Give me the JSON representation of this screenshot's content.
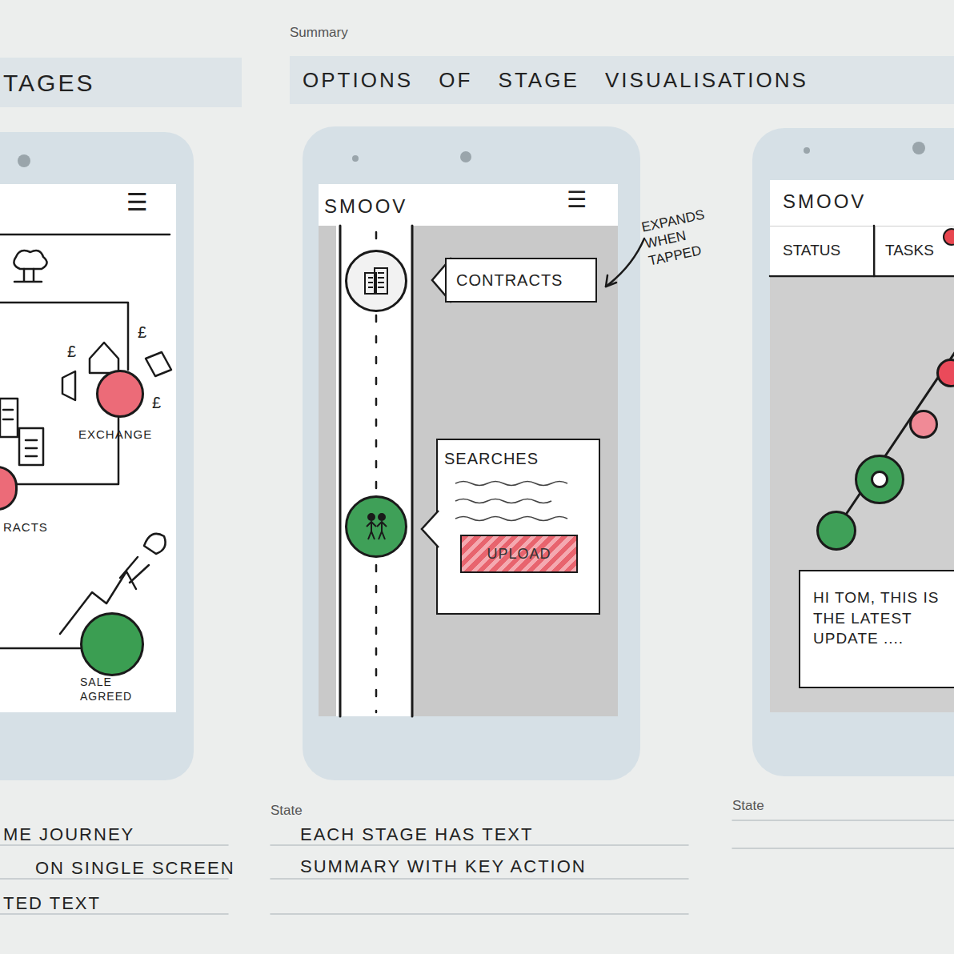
{
  "sheet": {
    "summary_label": "Summary",
    "title": "OPTIONS OF STAGE VISUALISATIONS"
  },
  "left_panel": {
    "title": "TAGES",
    "menu_icon": "☰",
    "money_symbols": [
      "£",
      "£",
      "£"
    ],
    "nodes": [
      {
        "label": "EXCHANGE",
        "color": "#ec6b78"
      },
      {
        "label": "RACTS",
        "color": "#ec6b78"
      },
      {
        "label": "SALE AGREED",
        "color": "#3b9e52"
      }
    ],
    "caption_lines": [
      "ME JOURNEY",
      "ON SINGLE SCREEN",
      "TED TEXT"
    ]
  },
  "middle_panel": {
    "app_name": "SMOOV",
    "menu_icon": "☰",
    "annotation": "EXPANDS WHEN TAPPED",
    "stages": [
      {
        "label": "CONTRACTS",
        "expanded": false,
        "color": "#f2f2f2"
      },
      {
        "label": "SEARCHES",
        "expanded": true,
        "color": "#3fa058"
      }
    ],
    "action_button": "UPLOAD",
    "caption_label": "State",
    "caption_lines": [
      "EACH STAGE HAS TEXT",
      "SUMMARY WITH KEY ACTION"
    ]
  },
  "right_panel": {
    "app_name": "SMOOV",
    "tabs": [
      {
        "label": "STATUS",
        "selected": false,
        "alert": false
      },
      {
        "label": "TASKS",
        "selected": false,
        "alert": true
      }
    ],
    "nodes": [
      {
        "color": "#ea4a5a",
        "kind": "dot"
      },
      {
        "color": "#f08a96",
        "kind": "dot"
      },
      {
        "color": "#3fa058",
        "kind": "ring"
      },
      {
        "color": "#3fa058",
        "kind": "dot"
      }
    ],
    "message": "HI TOM, THIS IS THE LATEST UPDATE ....",
    "caption_label": "State"
  }
}
